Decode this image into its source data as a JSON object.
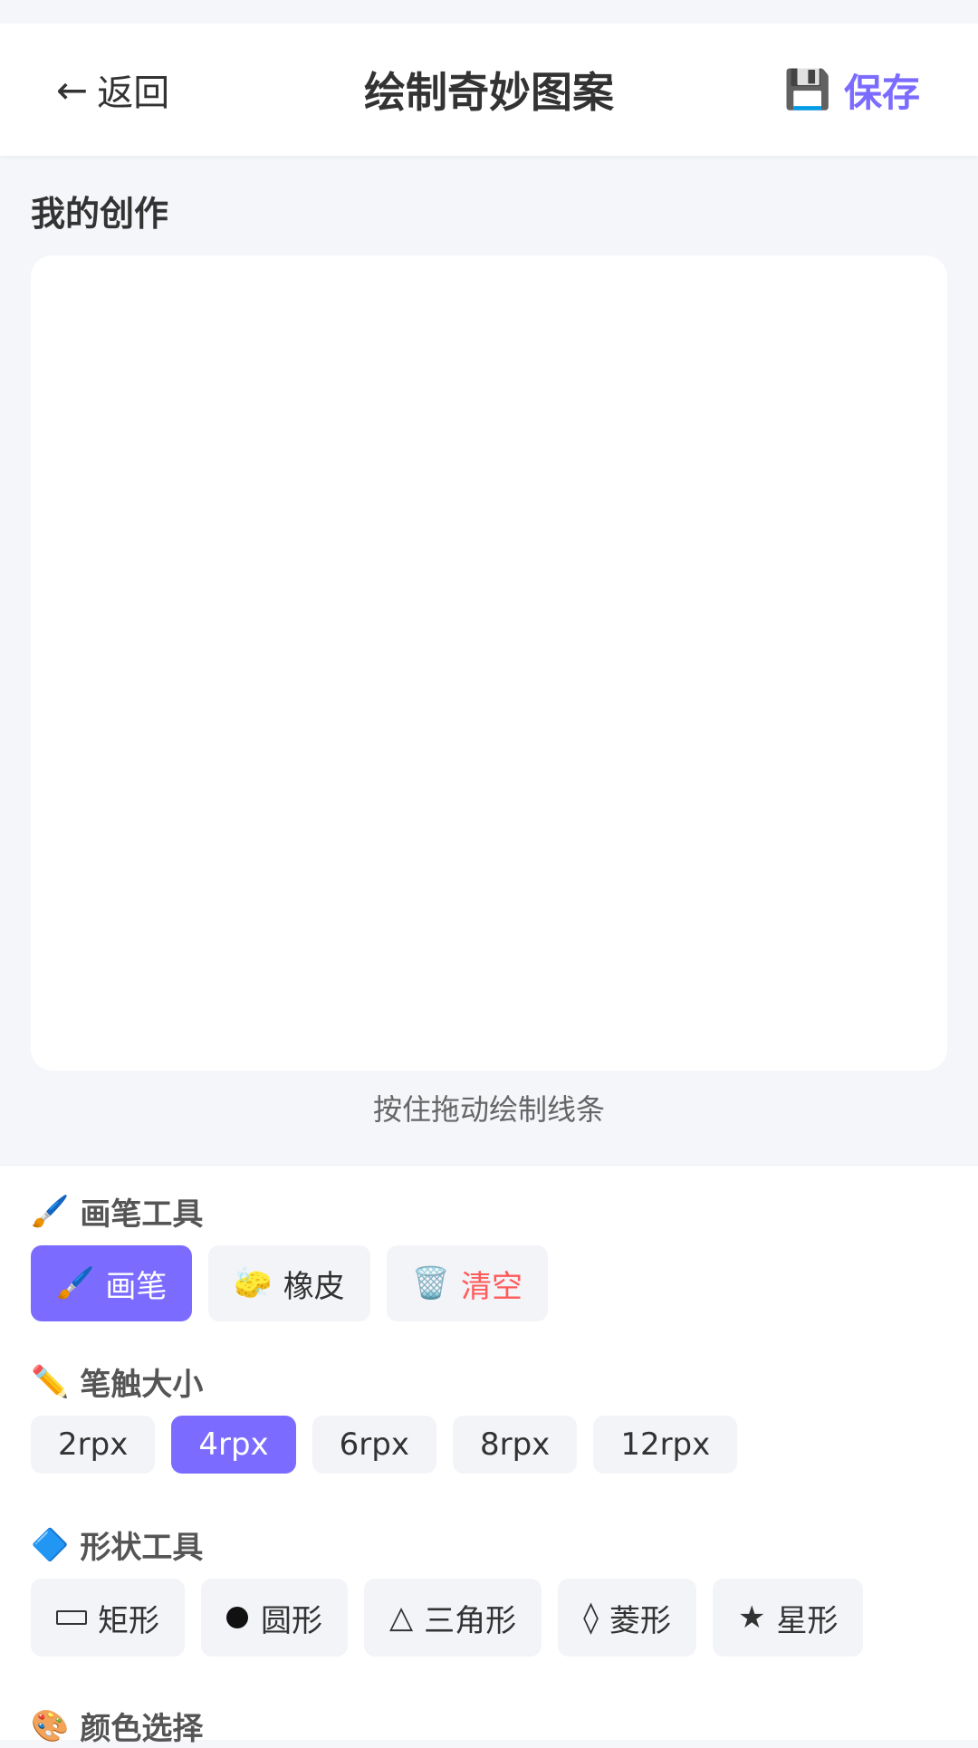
{
  "header": {
    "back_icon": "←",
    "back_label": "返回",
    "title": "绘制奇妙图案",
    "save_icon": "💾",
    "save_label": "保存",
    "accent": "#7b6cff"
  },
  "creation": {
    "title": "我的创作",
    "hint": "按住拖动绘制线条"
  },
  "brush_tools": {
    "icon": "🖌️",
    "title": "画笔工具",
    "items": [
      {
        "icon": "🖌️",
        "label": "画笔",
        "selected": true
      },
      {
        "icon": "🧽",
        "label": "橡皮",
        "selected": false
      },
      {
        "icon": "🗑️",
        "label": "清空",
        "selected": false
      }
    ]
  },
  "stroke_size": {
    "icon": "✏️",
    "title": "笔触大小",
    "items": [
      {
        "label": "2rpx",
        "selected": false
      },
      {
        "label": "4rpx",
        "selected": true
      },
      {
        "label": "6rpx",
        "selected": false
      },
      {
        "label": "8rpx",
        "selected": false
      },
      {
        "label": "12rpx",
        "selected": false
      }
    ]
  },
  "shape_tools": {
    "icon": "🔷",
    "title": "形状工具",
    "items": [
      {
        "icon": "rectangle-icon",
        "label": "矩形"
      },
      {
        "icon": "circle-icon",
        "label": "圆形"
      },
      {
        "icon": "△",
        "label": "三角形"
      },
      {
        "icon": "◊",
        "label": "菱形"
      },
      {
        "icon": "★",
        "label": "星形"
      }
    ]
  },
  "color_picker": {
    "icon": "🎨",
    "title": "颜色选择"
  }
}
